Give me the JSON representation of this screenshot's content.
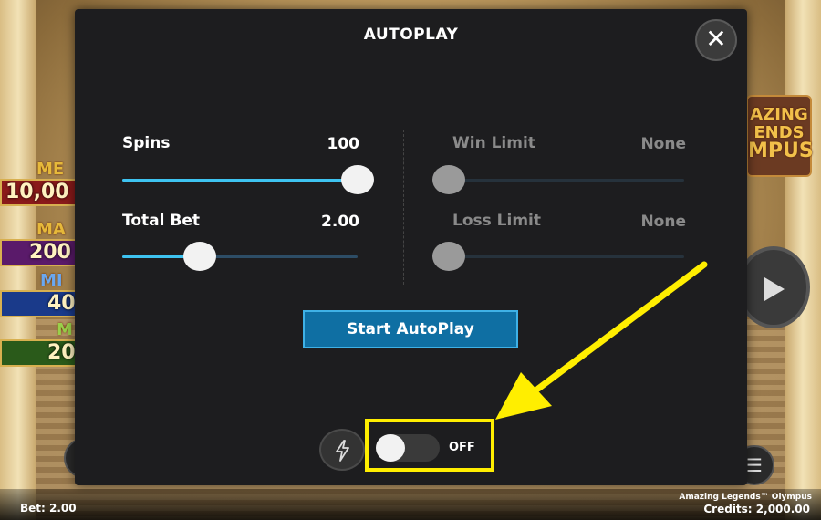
{
  "game": {
    "jackpots": [
      {
        "name": "ME",
        "value": "10,00"
      },
      {
        "name": "MA",
        "value": "200"
      },
      {
        "name": "MI",
        "value": "40"
      },
      {
        "name": "M",
        "value": "20"
      }
    ],
    "logo_text_1": "AZING",
    "logo_text_2": "ENDS",
    "logo_text_3": "MPUS",
    "menu_icon": "☰"
  },
  "modal": {
    "title": "AUTOPLAY",
    "close_label": "✕",
    "spins": {
      "label": "Spins",
      "value": "100",
      "fraction": 1.0
    },
    "total_bet": {
      "label": "Total Bet",
      "value": "2.00",
      "fraction": 0.33
    },
    "win_limit": {
      "label": "Win Limit",
      "value": "None",
      "fraction": 0.0
    },
    "loss_limit": {
      "label": "Loss Limit",
      "value": "None",
      "fraction": 0.0
    },
    "start_button": "Start AutoPlay",
    "turbo_icon": "lightning-icon",
    "toggle_state": "OFF"
  },
  "status": {
    "bet": "Bet: 2.00",
    "game_title": "Amazing Legends™ Olympus",
    "credits": "Credits: 2,000.00"
  },
  "colors": {
    "accent": "#3ec3f0",
    "start_button": "#0f6fa3",
    "highlight": "#ffee00"
  }
}
